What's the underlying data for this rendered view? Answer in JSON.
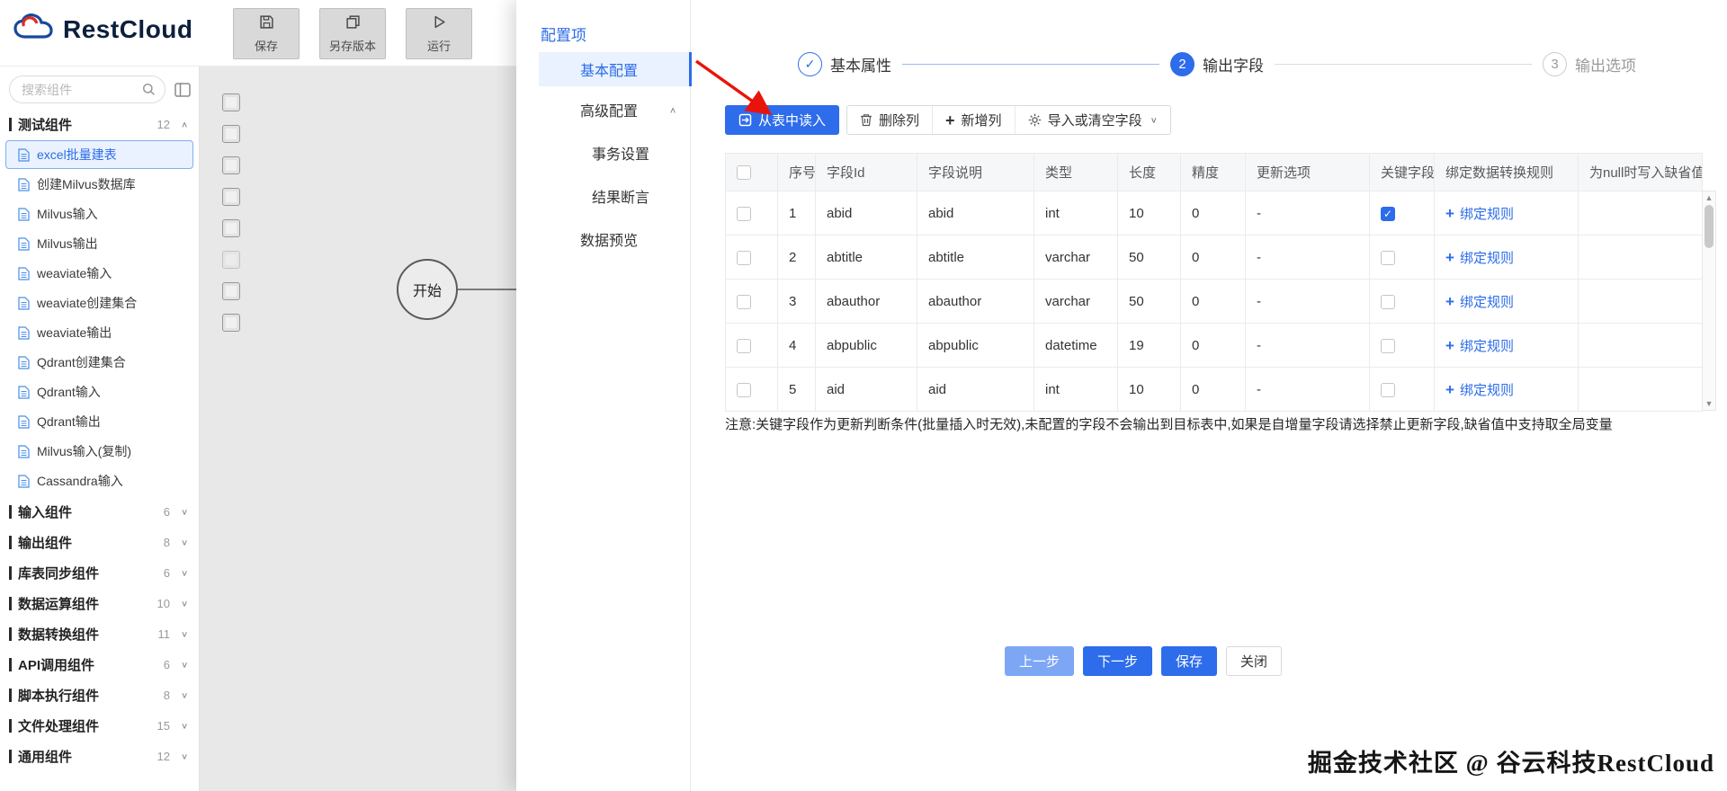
{
  "app": {
    "logo_text": "RestCloud",
    "watermark": "掘金技术社区 @ 谷云科技RestCloud"
  },
  "colors": {
    "primary": "#2d6cea",
    "selected_bg": "#e9f2fe",
    "arrow_red": "#e8140c",
    "canvas_bg": "#e8e8e8"
  },
  "header": {
    "buttons": [
      {
        "label": "保存",
        "icon": "save"
      },
      {
        "label": "另存版本",
        "icon": "save-as"
      },
      {
        "label": "运行",
        "icon": "run"
      }
    ]
  },
  "sidebar": {
    "search_placeholder": "搜索组件",
    "groups": [
      {
        "label": "测试组件",
        "count": "12",
        "expanded": true,
        "items": [
          {
            "label": "excel批量建表",
            "selected": true
          },
          {
            "label": "创建Milvus数据库"
          },
          {
            "label": "Milvus输入"
          },
          {
            "label": "Milvus输出"
          },
          {
            "label": "weaviate输入"
          },
          {
            "label": "weaviate创建集合"
          },
          {
            "label": "weaviate输出"
          },
          {
            "label": "Qdrant创建集合"
          },
          {
            "label": "Qdrant输入"
          },
          {
            "label": "Qdrant输出"
          },
          {
            "label": "Milvus输入(复制)"
          },
          {
            "label": "Cassandra输入"
          }
        ]
      },
      {
        "label": "输入组件",
        "count": "6",
        "expanded": false,
        "items": []
      },
      {
        "label": "输出组件",
        "count": "8",
        "expanded": false,
        "items": []
      },
      {
        "label": "库表同步组件",
        "count": "6",
        "expanded": false,
        "items": []
      },
      {
        "label": "数据运算组件",
        "count": "10",
        "expanded": false,
        "items": []
      },
      {
        "label": "数据转换组件",
        "count": "11",
        "expanded": false,
        "items": []
      },
      {
        "label": "API调用组件",
        "count": "6",
        "expanded": false,
        "items": []
      },
      {
        "label": "脚本执行组件",
        "count": "8",
        "expanded": false,
        "items": []
      },
      {
        "label": "文件处理组件",
        "count": "15",
        "expanded": false,
        "items": []
      },
      {
        "label": "通用组件",
        "count": "12",
        "expanded": false,
        "items": []
      }
    ]
  },
  "canvas": {
    "start_node_label": "开始",
    "palette_icon_count": 8
  },
  "dialog": {
    "title": "配置项",
    "menu": [
      {
        "label": "基本配置",
        "selected": true
      },
      {
        "label": "高级配置",
        "expanded": true
      },
      {
        "label": "事务设置",
        "indent": true
      },
      {
        "label": "结果断言",
        "indent": true
      },
      {
        "label": "数据预览"
      }
    ],
    "steps": [
      {
        "label": "基本属性",
        "status": "done"
      },
      {
        "label": "输出字段",
        "status": "active",
        "number": "2"
      },
      {
        "label": "输出选项",
        "status": "pending",
        "number": "3"
      }
    ],
    "toolbar": {
      "read_from_table": "从表中读入",
      "actions": [
        {
          "label": "删除列",
          "icon": "trash"
        },
        {
          "label": "新增列",
          "icon": "plus"
        },
        {
          "label": "导入或清空字段",
          "icon": "gear",
          "dropdown": true
        }
      ]
    },
    "table": {
      "headers": [
        "序号",
        "字段Id",
        "字段说明",
        "类型",
        "长度",
        "精度",
        "更新选项",
        "关键字段",
        "绑定数据转换规则",
        "为null时写入缺省值"
      ],
      "bind_rule_label": "绑定规则",
      "rows": [
        {
          "no": "1",
          "field_id": "abid",
          "field_desc": "abid",
          "type": "int",
          "length": "10",
          "precision": "0",
          "update_opt": "-",
          "key": true,
          "default_value": ""
        },
        {
          "no": "2",
          "field_id": "abtitle",
          "field_desc": "abtitle",
          "type": "varchar",
          "length": "50",
          "precision": "0",
          "update_opt": "-",
          "key": false,
          "default_value": ""
        },
        {
          "no": "3",
          "field_id": "abauthor",
          "field_desc": "abauthor",
          "type": "varchar",
          "length": "50",
          "precision": "0",
          "update_opt": "-",
          "key": false,
          "default_value": ""
        },
        {
          "no": "4",
          "field_id": "abpublic",
          "field_desc": "abpublic",
          "type": "datetime",
          "length": "19",
          "precision": "0",
          "update_opt": "-",
          "key": false,
          "default_value": ""
        },
        {
          "no": "5",
          "field_id": "aid",
          "field_desc": "aid",
          "type": "int",
          "length": "10",
          "precision": "0",
          "update_opt": "-",
          "key": false,
          "default_value": ""
        }
      ]
    },
    "note": "注意:关键字段作为更新判断条件(批量插入时无效),未配置的字段不会输出到目标表中,如果是自增量字段请选择禁止更新字段,缺省值中支持取全局变量",
    "footer_buttons": [
      {
        "label": "上一步",
        "style": "light"
      },
      {
        "label": "下一步",
        "style": "primary"
      },
      {
        "label": "保存",
        "style": "primary"
      },
      {
        "label": "关闭",
        "style": "default"
      }
    ]
  }
}
